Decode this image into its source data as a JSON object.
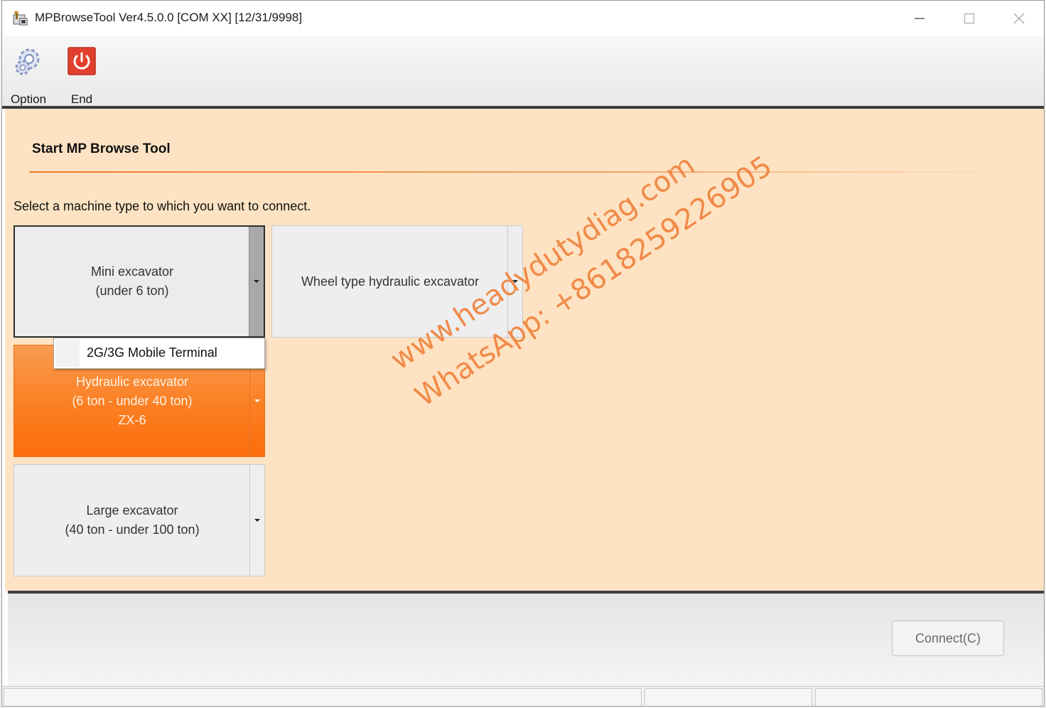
{
  "window": {
    "title": "MPBrowseTool Ver4.5.0.0 [COM XX] [12/31/9998]"
  },
  "toolbar": {
    "option_label": "Option",
    "end_label": "End"
  },
  "main": {
    "heading": "Start MP Browse Tool",
    "instruction": "Select a machine type to which you want to connect.",
    "machines": [
      {
        "line1": "Mini excavator",
        "line2": "(under 6 ton)",
        "line3": ""
      },
      {
        "line1": "Wheel type hydraulic excavator",
        "line2": "",
        "line3": ""
      },
      {
        "line1": "Hydraulic excavator",
        "line2": "(6 ton - under 40 ton)",
        "line3": "ZX-6"
      },
      {
        "line1": "Large excavator",
        "line2": "(40 ton - under 100 ton)",
        "line3": ""
      }
    ],
    "dropdown_item": "2G/3G Mobile Terminal",
    "selected_machine": "Hydraulic excavator"
  },
  "watermark": {
    "line1": "www.headydutydiag.com",
    "line2": "WhatsApp: +8618259226905"
  },
  "footer": {
    "connect_label": "Connect(C)"
  },
  "colors": {
    "panel_bg": "#fde3c3",
    "accent_orange": "#fb7f22",
    "watermark": "#f0833e"
  }
}
